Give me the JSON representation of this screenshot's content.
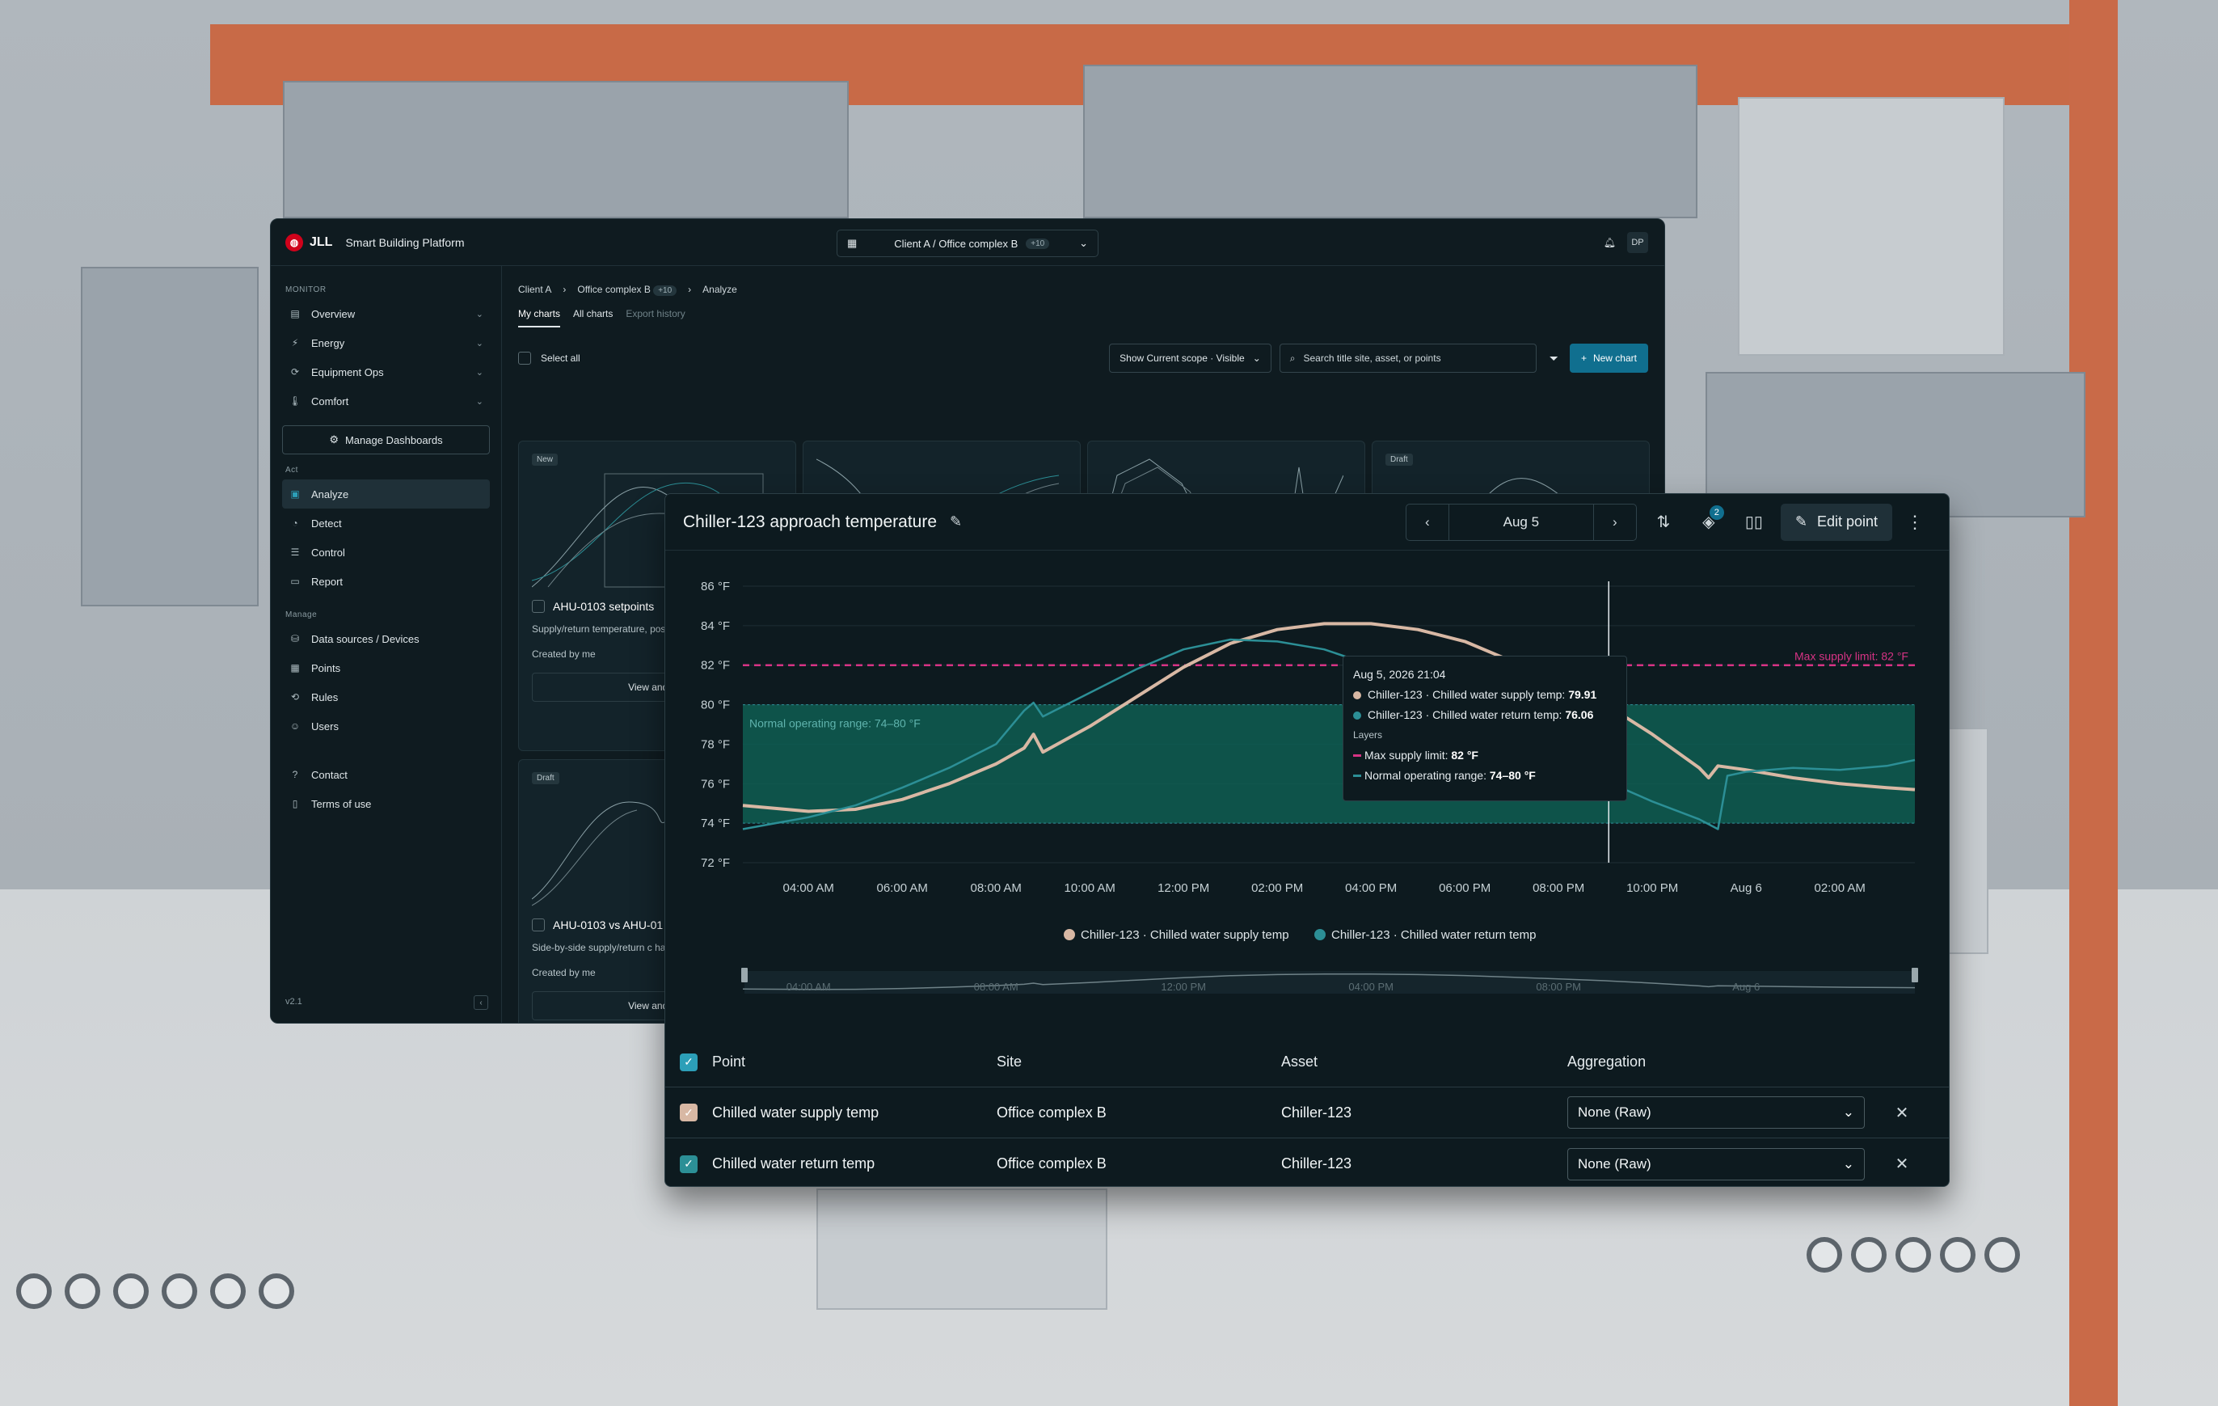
{
  "app": {
    "logo_mark": "◍",
    "brand": "JLL",
    "platform": "Smart Building Platform"
  },
  "scope_selector": {
    "label": "Client A / Office complex B",
    "count": "+10"
  },
  "user": {
    "initials": "DP"
  },
  "sidebar": {
    "monitor_label": "Monitor",
    "monitor": [
      {
        "label": "Overview",
        "icon": "grid-icon"
      },
      {
        "label": "Energy",
        "icon": "energy-icon"
      },
      {
        "label": "Equipment Ops",
        "icon": "equipment-icon"
      },
      {
        "label": "Comfort",
        "icon": "thermometer-icon"
      }
    ],
    "manage_dashboards": "Manage Dashboards",
    "act_label": "Act",
    "act": [
      {
        "label": "Analyze",
        "icon": "chart-icon"
      },
      {
        "label": "Detect",
        "icon": "bell-icon"
      },
      {
        "label": "Control",
        "icon": "sliders-icon"
      },
      {
        "label": "Report",
        "icon": "report-icon"
      }
    ],
    "manage_label": "Manage",
    "manage": [
      {
        "label": "Data sources / Devices",
        "icon": "database-icon"
      },
      {
        "label": "Points",
        "icon": "points-icon"
      },
      {
        "label": "Rules",
        "icon": "rules-icon"
      },
      {
        "label": "Users",
        "icon": "users-icon"
      }
    ],
    "footer_links": [
      {
        "label": "Contact",
        "icon": "help-icon"
      },
      {
        "label": "Terms of use",
        "icon": "document-icon"
      }
    ],
    "version": "v2.1"
  },
  "breadcrumb": {
    "items": [
      "Client A",
      "Office complex B",
      "Analyze"
    ],
    "pill": "+10"
  },
  "tabs": [
    "My charts",
    "All charts",
    "Export history"
  ],
  "toolbar": {
    "select_all": "Select all",
    "scope_filter": "Show Current scope · Visible",
    "search_placeholder": "Search title site, asset, or points",
    "new_chart": "New chart"
  },
  "cards": [
    {
      "tag": "New",
      "title": "AHU-0103 setpoints",
      "desc": "Supply/return temperature, position stacked by unit.",
      "created": "Created by me",
      "action": "View and edit"
    },
    {
      "tag": "Draft",
      "title": "AHU-0103 vs AHU-01",
      "desc": "Side-by-side supply/return c handlers.",
      "created": "Created by me",
      "action": "View and edit"
    },
    {
      "tag": "Draft"
    }
  ],
  "chart_window": {
    "title": "Chiller-123 approach temperature",
    "date": "Aug 5",
    "layers_count": "2",
    "edit_point": "Edit point"
  },
  "chart_data": {
    "type": "line",
    "y_unit": "°F",
    "ylim": [
      72,
      86
    ],
    "yticks": [
      "86 °F",
      "84 °F",
      "82 °F",
      "80 °F",
      "78 °F",
      "76 °F",
      "74 °F",
      "72 °F"
    ],
    "xticks": [
      "04:00 AM",
      "06:00 AM",
      "08:00 AM",
      "10:00 AM",
      "12:00 PM",
      "02:00 PM",
      "04:00 PM",
      "06:00 PM",
      "08:00 PM",
      "10:00 PM",
      "Aug 6",
      "02:00 AM"
    ],
    "x_start_hour": 2.6,
    "x_end_hour": 27.6,
    "series": [
      {
        "name": "Chiller-123 · Chilled water supply temp",
        "color": "#d8b8a4",
        "x": [
          2.6,
          4,
          5,
          6,
          7,
          8,
          8.6,
          8.8,
          9,
          10,
          11,
          12,
          13,
          14,
          15,
          16,
          17,
          18,
          19,
          20,
          21,
          21.07,
          22,
          23,
          23.2,
          23.4,
          24,
          25,
          26,
          27,
          27.6
        ],
        "y": [
          74.9,
          74.6,
          74.7,
          75.2,
          76.0,
          77.0,
          77.8,
          78.5,
          77.6,
          78.9,
          80.4,
          81.9,
          83.1,
          83.8,
          84.1,
          84.1,
          83.8,
          83.2,
          82.2,
          81.1,
          80.0,
          79.91,
          78.5,
          76.8,
          76.3,
          76.9,
          76.7,
          76.3,
          76.0,
          75.8,
          75.7
        ]
      },
      {
        "name": "Chiller-123 · Chilled water return temp",
        "color": "#2c8f96",
        "x": [
          2.6,
          4,
          5,
          6,
          7,
          8,
          8.6,
          8.8,
          9,
          10,
          11,
          12,
          13,
          14,
          15,
          16,
          17,
          18,
          19,
          20,
          21,
          21.07,
          22,
          23,
          23.4,
          23.6,
          24,
          25,
          26,
          27,
          27.6
        ],
        "y": [
          73.7,
          74.3,
          74.9,
          75.8,
          76.8,
          78.0,
          79.7,
          80.1,
          79.4,
          80.6,
          81.8,
          82.8,
          83.3,
          83.2,
          82.8,
          82.0,
          81.0,
          80.0,
          78.8,
          77.6,
          76.5,
          76.06,
          75.1,
          74.2,
          73.7,
          76.4,
          76.6,
          76.8,
          76.7,
          76.9,
          77.2
        ]
      }
    ],
    "layers": [
      {
        "name": "Max supply limit",
        "value": 82,
        "label": "Max supply limit: 82 °F",
        "color": "#d63384"
      },
      {
        "name": "Normal operating range",
        "range": [
          74,
          80
        ],
        "label": "Normal operating range: 74–80 °F",
        "color": "#0f5e52"
      }
    ],
    "cursor_hour": 21.07,
    "tooltip": {
      "date": "Aug 5, 2026 21:04",
      "supply_label": "Chiller-123 · Chilled water supply temp:",
      "supply_value": "79.91",
      "return_label": "Chiller-123 · Chilled water return temp:",
      "return_value": "76.06",
      "layers_label": "Layers",
      "max_label": "Max supply limit:",
      "max_value": "82 °F",
      "range_label": "Normal operating range:",
      "range_value": "74–80 °F"
    },
    "navigator_ticks": [
      "04:00 AM",
      "08:00 AM",
      "12:00 PM",
      "04:00 PM",
      "08:00 PM",
      "Aug 6"
    ],
    "legend_position": "bottom-center"
  },
  "points_table": {
    "headers": [
      "Point",
      "Site",
      "Asset",
      "Aggregation"
    ],
    "rows": [
      {
        "point": "Chilled water supply temp",
        "site": "Office complex B",
        "asset": "Chiller-123",
        "aggregation": "None (Raw)",
        "color": "#d8b8a4"
      },
      {
        "point": "Chilled water return temp",
        "site": "Office complex B",
        "asset": "Chiller-123",
        "aggregation": "None (Raw)",
        "color": "#2c8f96"
      }
    ]
  }
}
